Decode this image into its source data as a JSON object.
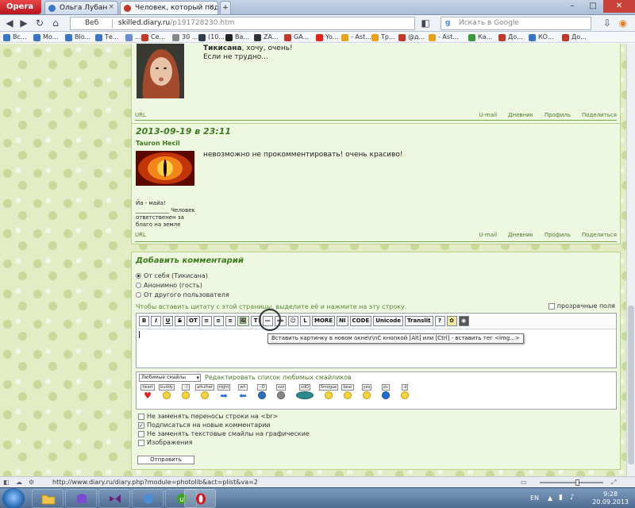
{
  "browser": {
    "menu_label": "Opera",
    "tabs": [
      {
        "title": "Ольга Лубан",
        "active": false
      },
      {
        "title": "Человек, который под...",
        "active": true
      }
    ],
    "web_label": "Веб",
    "url_host": "skilled.diary.ru",
    "url_path": "/p191728230.htm",
    "search_placeholder": "Искать в Google",
    "bookmarks": [
      "Вс...",
      "Мо...",
      "Blo...",
      "Те...",
      "...",
      "Се...",
      "30 ...",
      "(10...",
      "Ва...",
      "ZA...",
      "GA...",
      "Yo...",
      "- Ast...",
      "Тр...",
      "@д...",
      "- Ast...",
      "Ка...",
      "До...",
      "КО...",
      "До..."
    ]
  },
  "post1": {
    "author_line": "Тикисана",
    "text_suffix": ", хочу, очень!",
    "text_line2": "Если не трудно...",
    "footer": {
      "url": "URL",
      "links": [
        "U-mail",
        "Дневник",
        "Профиль",
        "Поделиться"
      ]
    }
  },
  "post2": {
    "date": "2013-09-19 в 23:11",
    "author": "Tauron Hecil",
    "text": "невозможно не прокомментировать! очень красиво!",
    "signature": "Йа - майа! ____________ Человек ответственен за благо на земле",
    "footer": {
      "url": "URL",
      "links": [
        "U-mail",
        "Дневник",
        "Профиль",
        "Поделиться"
      ]
    }
  },
  "comment_form": {
    "title": "Добавить комментарий",
    "radios": [
      {
        "label": "От себя (Тикисана)",
        "selected": true
      },
      {
        "label": "Анонимно (гость)",
        "selected": false
      },
      {
        "label": "От другого пользователя",
        "selected": false
      }
    ],
    "quote_hint": "Чтобы вставить цитату с этой страницы, выделите её и нажмите на эту строку.",
    "transparent_fields": "прозрачные поля",
    "toolbar_buttons": [
      "B",
      "I",
      "U",
      "S",
      "ОТ",
      "≡",
      "≡",
      "≡",
      "🖼",
      "T",
      "—",
      "«»",
      "☺",
      "L",
      "MORE",
      "NI",
      "CODE",
      "Unicode",
      "Translit",
      "?"
    ],
    "tooltip": "Вставить картинку в новом окне\\r\\nC кнопкой [Alt] или [Ctrl] - вставить тег <img...>",
    "smiley_select": "Любимые смайлы",
    "smiley_edit_link": "Редактировать список любимых смайликов",
    "smiley_tags": [
      "heart",
      "buddy",
      ":-)",
      "attulhet",
      "night",
      "wh",
      ":-D",
      "ozz",
      "xdD",
      "Smogue",
      "bear",
      "yes",
      "ps",
      ":d"
    ],
    "options": [
      {
        "label": "Не заменять переносы строки на <br>",
        "checked": false
      },
      {
        "label": "Подписаться на новые комментарии",
        "checked": true
      },
      {
        "label": "Не заменять текстовые смайлы на графические",
        "checked": false
      },
      {
        "label": "Изображения",
        "checked": false
      }
    ],
    "submit_label": "Отправить"
  },
  "status_bar": {
    "url": "http://www.diary.ru/diary.php?module=photolib&act=plist&va=2"
  },
  "taskbar": {
    "lang": "EN",
    "time": "9:28",
    "date": "20.09.2013"
  }
}
